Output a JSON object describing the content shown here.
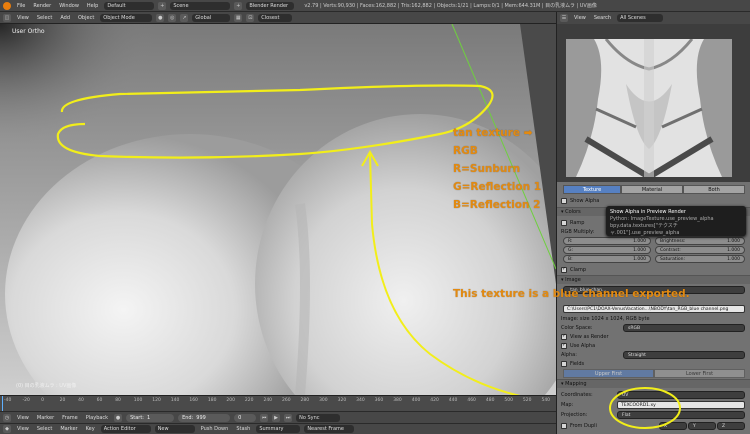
{
  "topbar": {
    "menus": [
      "File",
      "Render",
      "Window",
      "Help"
    ],
    "layout": "Default",
    "scene": "Scene",
    "engine": "Blender Render",
    "stats": "v2.79 | Verts:90,930 | Faces:162,882 | Tris:162,882 | Objects:1/21 | Lamps:0/1 | Mem:644.31M | 目の乳液ムラ | UV画像"
  },
  "viewport": {
    "header_menus": [
      "View",
      "Select",
      "Add",
      "Object"
    ],
    "mode": "Object Mode",
    "orientation": "Global",
    "pivot": "Closest",
    "view_label": "User Ortho",
    "object_label": "(0) 目の乳液ムラ : UV画像"
  },
  "annotations": {
    "line1": "tan texture ➡",
    "line2": "RGB",
    "line3": "R=Sunburn",
    "line4": "G=Reflection 1",
    "line5": "B=Reflection 2",
    "exported": "This texture is a blue channel exported."
  },
  "timeline": {
    "ticks": [
      "-40",
      "-20",
      "0",
      "20",
      "40",
      "60",
      "80",
      "100",
      "120",
      "140",
      "160",
      "180",
      "200",
      "220",
      "240",
      "260",
      "280",
      "300",
      "320",
      "340",
      "360",
      "380",
      "400",
      "420",
      "440",
      "460",
      "480",
      "500",
      "520",
      "540"
    ],
    "menus": [
      "View",
      "Marker",
      "Frame",
      "Playback"
    ],
    "start_label": "Start:",
    "start_value": "1",
    "end_label": "End:",
    "end_value": "999",
    "current": "0",
    "sync": "No Sync"
  },
  "action_bar": {
    "menus": [
      "View",
      "Select",
      "Marker",
      "Key"
    ],
    "editor": "Action Editor",
    "new_label": "New",
    "push_down": "Push Down",
    "stash": "Stash",
    "summary": "Summary",
    "snap": "Nearest Frame"
  },
  "right_header": {
    "menus": [
      "View",
      "Search"
    ],
    "scenes": "All Scenes"
  },
  "properties": {
    "tabs": [
      "Texture",
      "Material",
      "Both"
    ],
    "show_alpha": "Show Alpha",
    "colors_panel": "Colors",
    "ramp": "Ramp",
    "rgb_multiply": "RGB Multiply:",
    "r_label": "R:",
    "r_value": "1.000",
    "g_label": "G:",
    "g_value": "1.000",
    "b_label": "B:",
    "b_value": "1.000",
    "brightness_label": "Brightness:",
    "brightness_value": "1.000",
    "contrast_label": "Contrast:",
    "contrast_value": "1.000",
    "saturation_label": "Saturation:",
    "saturation_value": "1.000",
    "clamp": "Clamp",
    "image_panel": "Image",
    "image_name": "_tan_blue chan...",
    "filepath": "C:\\Users\\PC1\\DOAX-VenusVacation...\\NBODY\\tan_RGB_blue channel.png",
    "image_info": "Image: size 1024 x 1024, RGB byte",
    "color_space_label": "Color Space:",
    "color_space": "sRGB",
    "view_as_render": "View as Render",
    "use_alpha": "Use Alpha",
    "alpha_label": "Alpha:",
    "alpha_value": "Straight",
    "fields": "Fields",
    "upper_first": "Upper First",
    "lower_first": "Lower First",
    "mapping_panel": "Mapping",
    "coordinates_label": "Coordinates:",
    "coordinates": "UV",
    "map_label": "Map:",
    "map_value": "TEXCOORD1.xy",
    "projection_label": "Projection:",
    "projection": "Flat",
    "from_dupli": "From Dupli",
    "x": "X",
    "y": "Y",
    "z": "Z"
  },
  "tooltip": {
    "title": "Show Alpha in Preview Render",
    "python": "Python: ImageTexture.use_preview_alpha",
    "path": "bpy.data.textures[\"テクスチャ.001\"].use_preview_alpha"
  },
  "colors": {
    "annotation": "#e38a10",
    "highlight": "#f2ee1a",
    "accent": "#5680c2",
    "blender_orange": "#e87d0d"
  }
}
